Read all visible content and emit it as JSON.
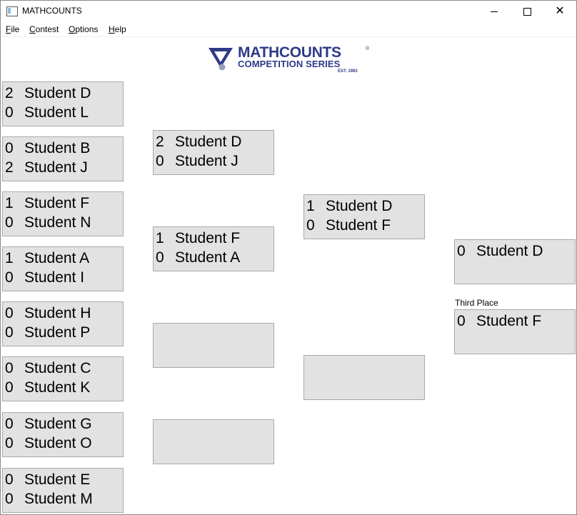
{
  "window": {
    "title": "MATHCOUNTS",
    "close_glyph": "✕"
  },
  "menu": [
    {
      "underline": "F",
      "rest": "ile"
    },
    {
      "underline": "C",
      "rest": "ontest"
    },
    {
      "underline": "O",
      "rest": "ptions"
    },
    {
      "underline": "H",
      "rest": "elp"
    }
  ],
  "logo": {
    "line1": "MATHCOUNTS",
    "reg": "®",
    "line2": "COMPETITION SERIES",
    "line3": "EST. 1983",
    "brand_color": "#2e3a87"
  },
  "bracket": {
    "round1": [
      {
        "a": {
          "score": "2",
          "name": "Student D"
        },
        "b": {
          "score": "0",
          "name": "Student L"
        }
      },
      {
        "a": {
          "score": "0",
          "name": "Student B"
        },
        "b": {
          "score": "2",
          "name": "Student J"
        }
      },
      {
        "a": {
          "score": "1",
          "name": "Student F"
        },
        "b": {
          "score": "0",
          "name": "Student N"
        }
      },
      {
        "a": {
          "score": "1",
          "name": "Student A"
        },
        "b": {
          "score": "0",
          "name": "Student I"
        }
      },
      {
        "a": {
          "score": "0",
          "name": "Student H"
        },
        "b": {
          "score": "0",
          "name": "Student P"
        }
      },
      {
        "a": {
          "score": "0",
          "name": "Student C"
        },
        "b": {
          "score": "0",
          "name": "Student K"
        }
      },
      {
        "a": {
          "score": "0",
          "name": "Student G"
        },
        "b": {
          "score": "0",
          "name": "Student O"
        }
      },
      {
        "a": {
          "score": "0",
          "name": "Student E"
        },
        "b": {
          "score": "0",
          "name": "Student M"
        }
      }
    ],
    "round2": [
      {
        "a": {
          "score": "2",
          "name": "Student D"
        },
        "b": {
          "score": "0",
          "name": "Student J"
        }
      },
      {
        "a": {
          "score": "1",
          "name": "Student F"
        },
        "b": {
          "score": "0",
          "name": "Student A"
        }
      }
    ],
    "semifinal": [
      {
        "a": {
          "score": "1",
          "name": "Student D"
        },
        "b": {
          "score": "0",
          "name": "Student F"
        }
      }
    ],
    "final": {
      "a": {
        "score": "0",
        "name": "Student D"
      }
    },
    "third_place": {
      "label": "Third Place",
      "a": {
        "score": "0",
        "name": "Student F"
      }
    }
  }
}
